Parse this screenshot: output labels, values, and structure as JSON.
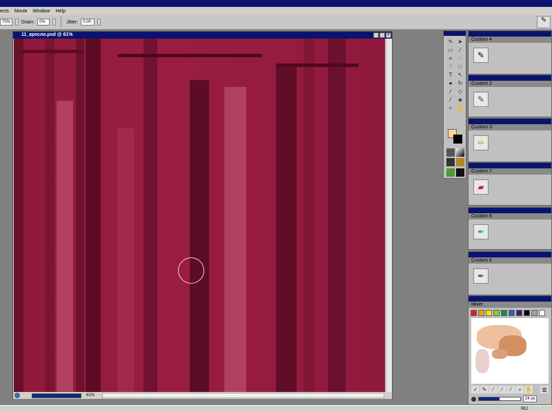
{
  "menu": [
    "ects",
    "Movie",
    "Window",
    "Help"
  ],
  "propbar": {
    "opacity": "70%",
    "grain_label": "Grain:",
    "grain": "0%",
    "jitter_label": "Jitter:",
    "jitter": "0.00"
  },
  "document": {
    "title": "11_кресло.psd @ 61%",
    "zoom": "61%"
  },
  "palettes": [
    {
      "name": "Custom  4",
      "icon": "brush-icon"
    },
    {
      "name": "Custom  2",
      "icon": "brush-icon"
    },
    {
      "name": "Custom  3",
      "icon": "pencil-icon"
    },
    {
      "name": "Custom  7",
      "icon": "eraser-icon"
    },
    {
      "name": "Custom  8",
      "icon": "pen-icon"
    },
    {
      "name": "Custom  6",
      "icon": "pen-icon"
    }
  ],
  "mixer": {
    "title": "Mixer",
    "swatches": [
      "#d8202a",
      "#f0a000",
      "#f4e400",
      "#8cc83c",
      "#109040",
      "#2860b0",
      "#401a70",
      "#000000",
      "#a0a0a0",
      "#ffffff"
    ],
    "brush_size": "24 px"
  },
  "colors": {
    "main": "#fcd49c",
    "secondary": "#000000"
  },
  "taskbar": {
    "lang": "RU"
  }
}
